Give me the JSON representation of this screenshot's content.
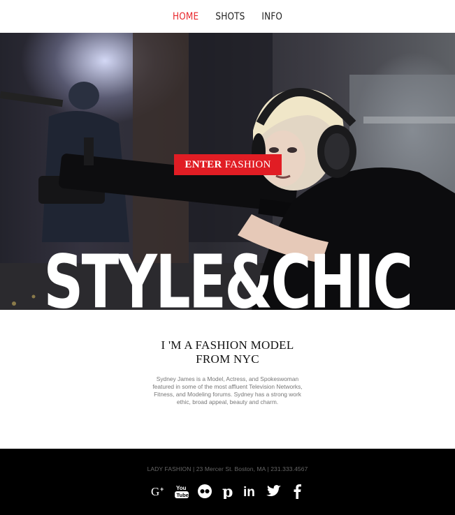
{
  "nav": {
    "items": [
      {
        "label": "HOME",
        "active": true
      },
      {
        "label": "SHOTS",
        "active": false
      },
      {
        "label": "INFO",
        "active": false
      }
    ]
  },
  "hero": {
    "cta_bold": "ENTER",
    "cta_light": "FASHION",
    "headline": "STYLE&CHIC"
  },
  "about": {
    "title_line1": "I 'M A FASHION MODEL",
    "title_line2": "FROM NYC",
    "body": "Sydney James is a Model, Actress, and Spokeswoman featured in some of the most affluent Television Networks, Fitness, and Modeling forums. Sydney has a strong work ethic, broad appeal, beauty and charm."
  },
  "footer": {
    "address": "LADY FASHION | 23 Mercer St. Boston, MA | 231.333.4567",
    "social": [
      "google-plus-icon",
      "youtube-icon",
      "flickr-icon",
      "pinterest-icon",
      "linkedin-icon",
      "twitter-icon",
      "facebook-icon"
    ]
  },
  "colors": {
    "accent": "#e8262b",
    "cta_bg": "#e11d24",
    "footer_bg": "#000000",
    "body_text": "#777777"
  }
}
